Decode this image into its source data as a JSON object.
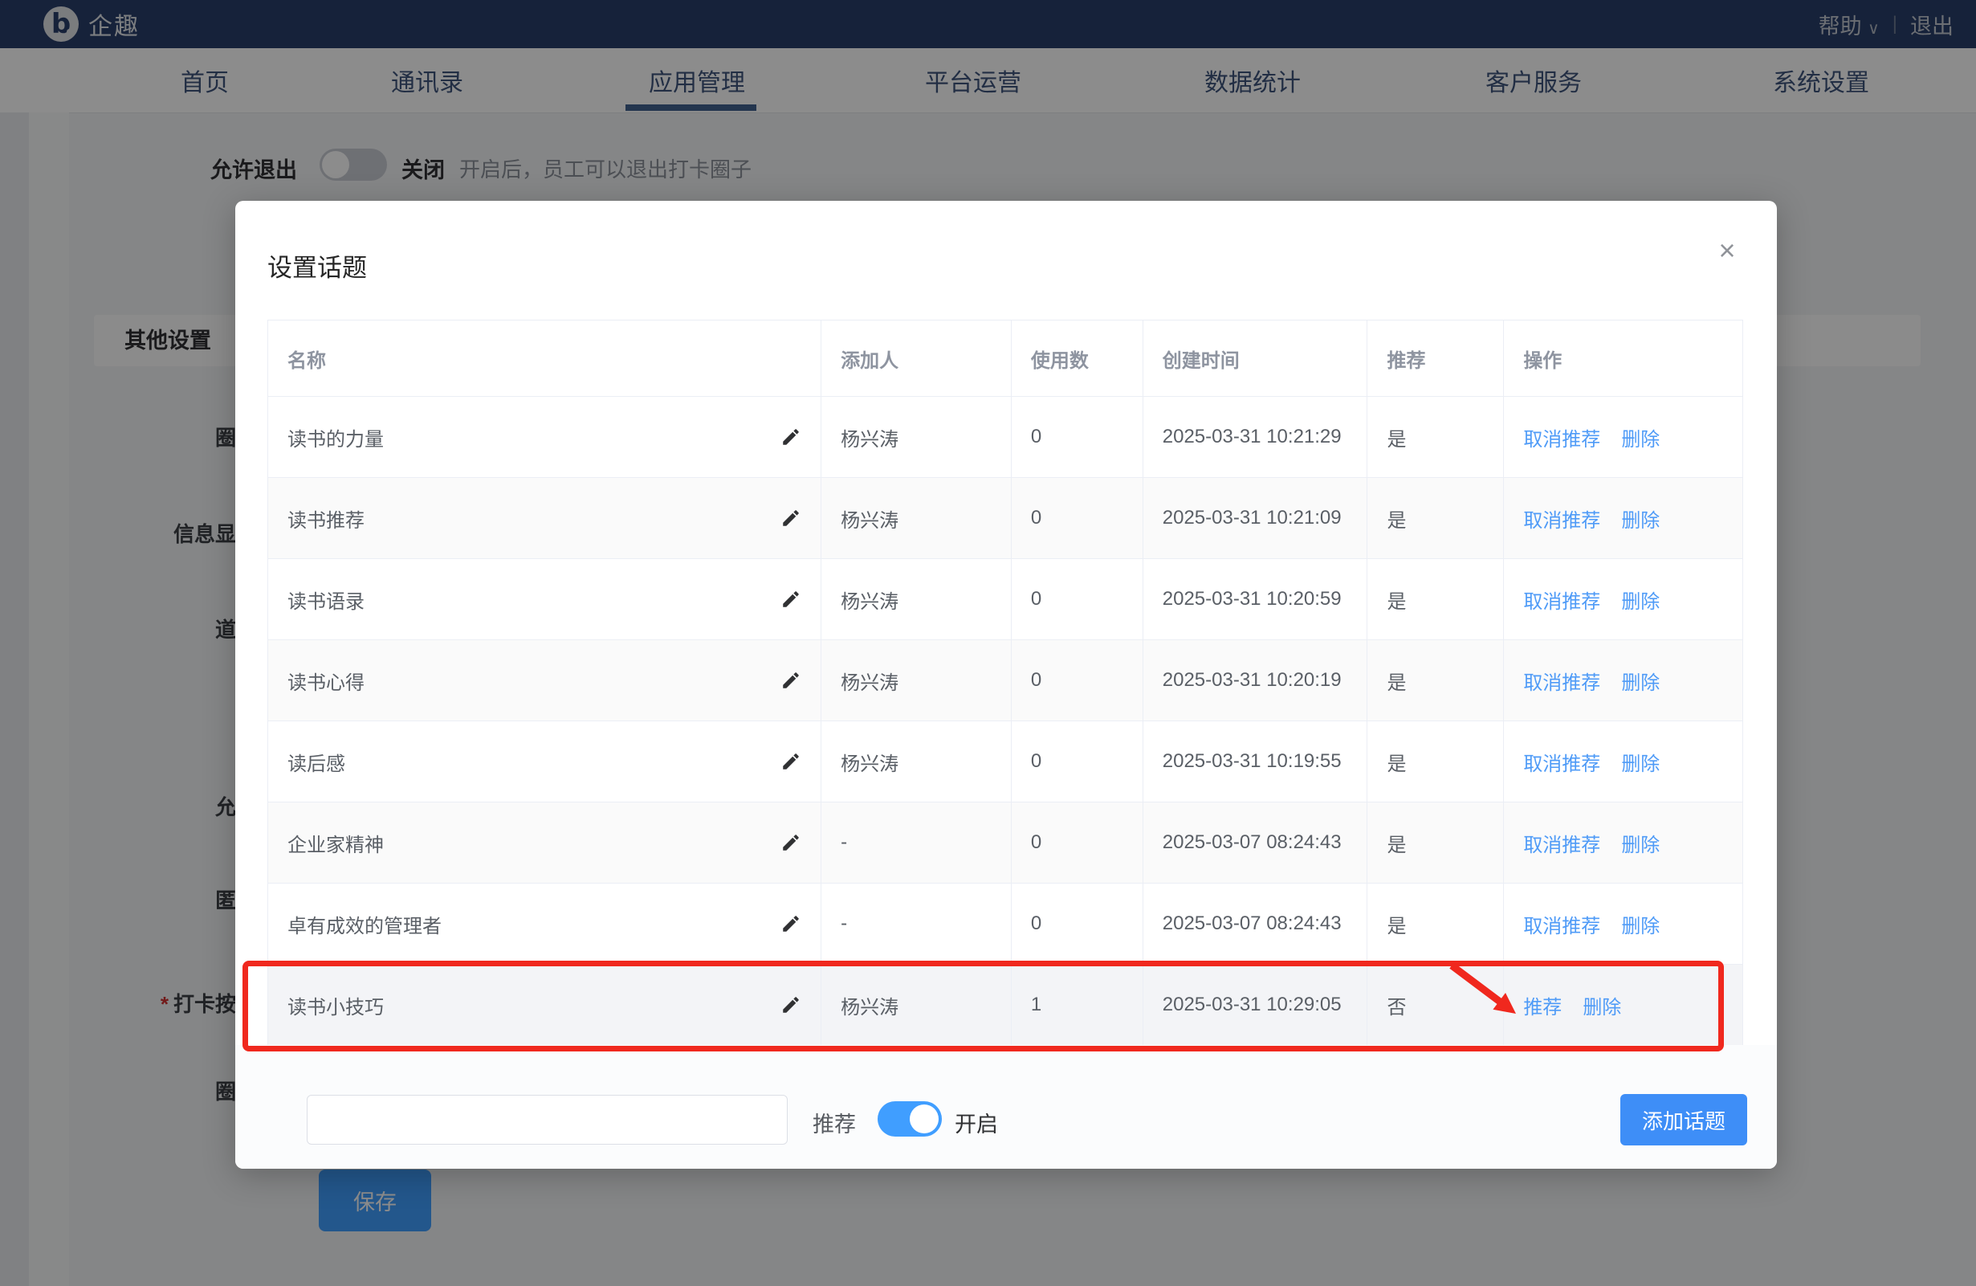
{
  "topbar": {
    "brand": "企趣",
    "logo_letter": "b",
    "help": "帮助",
    "caret": "∨",
    "divider": "|",
    "logout": "退出"
  },
  "nav": {
    "items": [
      "首页",
      "通讯录",
      "应用管理",
      "平台运营",
      "数据统计",
      "客户服务",
      "系统设置"
    ],
    "active": "应用管理"
  },
  "page": {
    "allow_exit": {
      "label": "允许退出",
      "state": "关闭",
      "hint": "开启后，员工可以退出打卡圈子"
    },
    "section_title": "其他设置",
    "required_marker": "*",
    "clipped_labels": [
      "圈",
      "信息显",
      "道",
      "允",
      "匿",
      "打卡按",
      "圈"
    ],
    "save_button": "保存"
  },
  "modal": {
    "title": "设置话题",
    "close_icon": "×",
    "table": {
      "columns": [
        "名称",
        "添加人",
        "使用数",
        "创建时间",
        "推荐",
        "操作"
      ],
      "rows": [
        {
          "name": "读书的力量",
          "adder": "杨兴涛",
          "uses": "0",
          "created": "2025-03-31 10:21:29",
          "recommended": "是",
          "actions": [
            "取消推荐",
            "删除"
          ],
          "highlighted": false
        },
        {
          "name": "读书推荐",
          "adder": "杨兴涛",
          "uses": "0",
          "created": "2025-03-31 10:21:09",
          "recommended": "是",
          "actions": [
            "取消推荐",
            "删除"
          ],
          "highlighted": false
        },
        {
          "name": "读书语录",
          "adder": "杨兴涛",
          "uses": "0",
          "created": "2025-03-31 10:20:59",
          "recommended": "是",
          "actions": [
            "取消推荐",
            "删除"
          ],
          "highlighted": false
        },
        {
          "name": "读书心得",
          "adder": "杨兴涛",
          "uses": "0",
          "created": "2025-03-31 10:20:19",
          "recommended": "是",
          "actions": [
            "取消推荐",
            "删除"
          ],
          "highlighted": false
        },
        {
          "name": "读后感",
          "adder": "杨兴涛",
          "uses": "0",
          "created": "2025-03-31 10:19:55",
          "recommended": "是",
          "actions": [
            "取消推荐",
            "删除"
          ],
          "highlighted": false
        },
        {
          "name": "企业家精神",
          "adder": "-",
          "uses": "0",
          "created": "2025-03-07 08:24:43",
          "recommended": "是",
          "actions": [
            "取消推荐",
            "删除"
          ],
          "highlighted": false
        },
        {
          "name": "卓有成效的管理者",
          "adder": "-",
          "uses": "0",
          "created": "2025-03-07 08:24:43",
          "recommended": "是",
          "actions": [
            "取消推荐",
            "删除"
          ],
          "highlighted": false
        },
        {
          "name": "读书小技巧",
          "adder": "杨兴涛",
          "uses": "1",
          "created": "2025-03-31 10:29:05",
          "recommended": "否",
          "actions": [
            "推荐",
            "删除"
          ],
          "highlighted": true
        }
      ]
    },
    "footer": {
      "input_value": "",
      "recommend_label": "推荐",
      "toggle_state_label": "开启",
      "add_button": "添加话题"
    }
  },
  "colors": {
    "primary_blue": "#409eff",
    "link_blue": "#4f9bf7",
    "highlight_red": "#f0281e",
    "header_navy": "#283e6b"
  }
}
